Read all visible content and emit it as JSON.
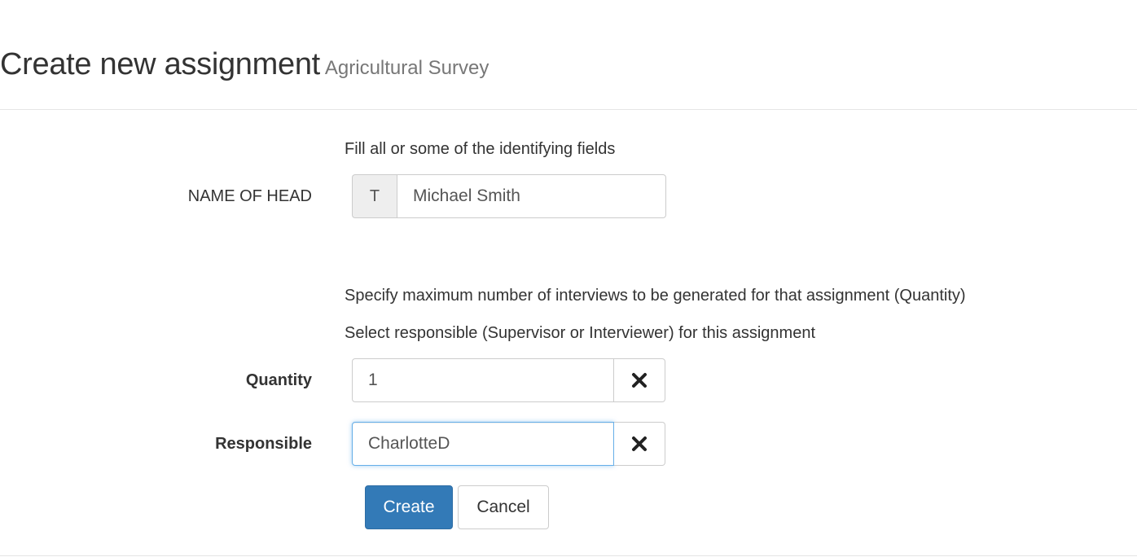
{
  "header": {
    "title": "Create new assignment",
    "subtitle": "Agricultural Survey"
  },
  "identifying": {
    "hint": "Fill all or some of the identifying fields",
    "fields": [
      {
        "label": "NAME OF HEAD",
        "type_badge": "T",
        "value": "Michael Smith"
      }
    ]
  },
  "hints": {
    "quantity": "Specify maximum number of interviews to be generated for that assignment (Quantity)",
    "responsible": "Select responsible (Supervisor or Interviewer) for this assignment"
  },
  "quantity": {
    "label": "Quantity",
    "value": "1",
    "clear_icon": "times-icon"
  },
  "responsible": {
    "label": "Responsible",
    "value": "CharlotteD",
    "clear_icon": "times-icon"
  },
  "actions": {
    "create_label": "Create",
    "cancel_label": "Cancel"
  },
  "colors": {
    "primary": "#337ab7",
    "focus": "#66afe9"
  }
}
